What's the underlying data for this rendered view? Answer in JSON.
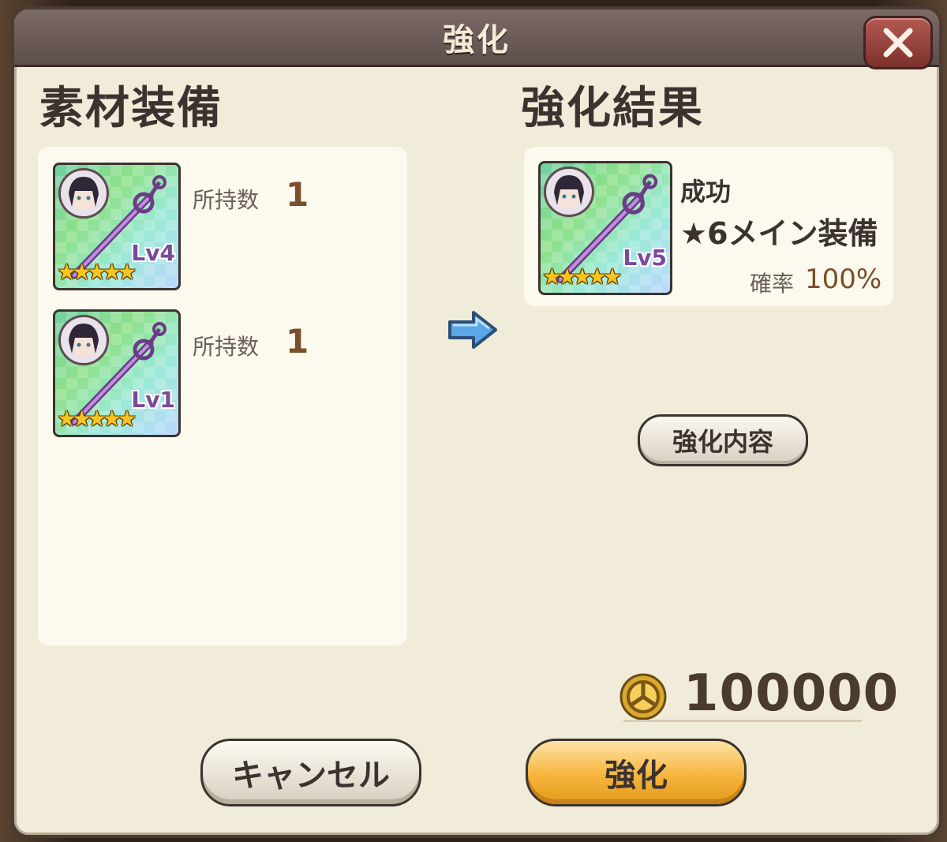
{
  "dialog": {
    "title": "強化",
    "close_icon": "close-icon"
  },
  "materials": {
    "heading": "素材装備",
    "items": [
      {
        "level": "Lv4",
        "stars": "★★★★★",
        "count_label": "所持数",
        "count": "1"
      },
      {
        "level": "Lv1",
        "stars": "★★★★★",
        "count_label": "所持数",
        "count": "1"
      }
    ]
  },
  "result": {
    "heading": "強化結果",
    "item": {
      "level": "Lv5",
      "stars": "★★★★★"
    },
    "status": "成功",
    "name": "★6メイン装備",
    "rate_label": "確率",
    "rate_value": "100%",
    "detail_button": "強化内容"
  },
  "cost": {
    "icon": "coin-icon",
    "amount": "100000"
  },
  "buttons": {
    "cancel": "キャンセル",
    "confirm": "強化"
  },
  "colors": {
    "title_bar": "#5e4e4b",
    "panel": "#fcf9ee",
    "confirm_button": "#f7b53c",
    "accent_text": "#7a4f2b"
  }
}
